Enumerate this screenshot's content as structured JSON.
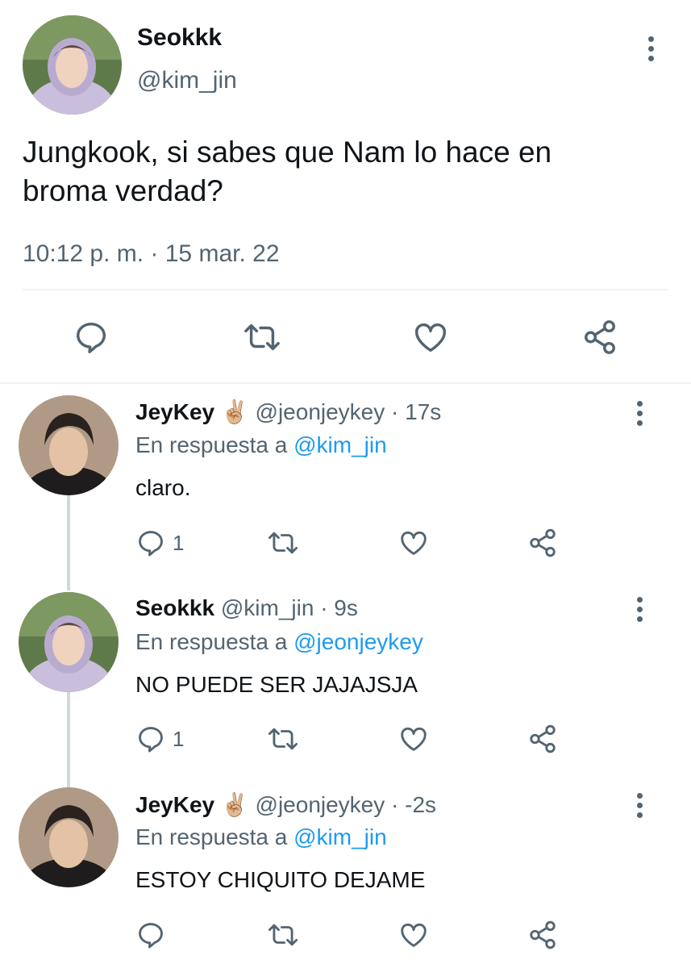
{
  "main_tweet": {
    "display_name": "Seokkk",
    "handle": "@kim_jin",
    "text_line1": "Jungkook, si sabes que Nam lo hace en",
    "text_line2": "broma verdad?",
    "timestamp": "10:12 p. m. · 15 mar. 22"
  },
  "replies": [
    {
      "display_name": "JeyKey",
      "emoji": "✌🏼",
      "meta": "@jeonjeykey · 17s",
      "reply_prefix": "En respuesta a",
      "reply_to": "@kim_jin",
      "text": "claro.",
      "reply_count": "1"
    },
    {
      "display_name": "Seokkk",
      "emoji": "",
      "meta": "@kim_jin · 9s",
      "reply_prefix": "En respuesta a",
      "reply_to": "@jeonjeykey",
      "text": "NO PUEDE SER JAJAJSJA",
      "reply_count": "1"
    },
    {
      "display_name": "JeyKey",
      "emoji": "✌🏼",
      "meta": "@jeonjeykey · -2s",
      "reply_prefix": "En respuesta a",
      "reply_to": "@kim_jin",
      "text": "ESTOY CHIQUITO DEJAME",
      "reply_count": ""
    }
  ],
  "icons": {
    "reply": "reply-icon",
    "retweet": "retweet-icon",
    "like": "like-icon",
    "share": "share-icon",
    "more": "more-icon"
  },
  "colors": {
    "text": "#0f1419",
    "muted": "#536471",
    "link": "#1d9bf0",
    "divider": "#eff3f4",
    "thread_line": "#cfd9de"
  }
}
